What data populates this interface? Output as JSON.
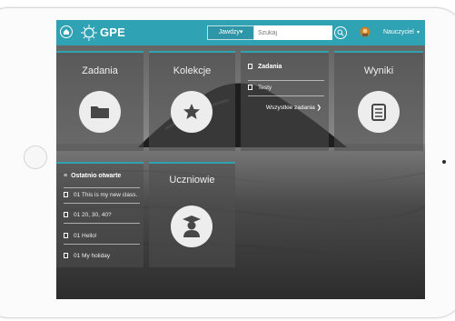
{
  "topbar": {
    "logo_text": "GPE",
    "search_scope": "Jawdzy",
    "search_placeholder": "Szukaj",
    "user_label": "Nauczyciel",
    "user_caret": "▾"
  },
  "tiles": {
    "zadania": {
      "title": "Zadania",
      "icon": "folder-icon"
    },
    "kolekcje": {
      "title": "Kolekcje",
      "icon": "star-icon"
    },
    "wyniki": {
      "title": "Wyniki",
      "icon": "document-list-icon"
    },
    "uczniowie": {
      "title": "Uczniowie",
      "icon": "student-icon"
    },
    "assignments_list": {
      "title": "Zadania",
      "items": [
        "Testy"
      ],
      "more_link": "Wszystkie zadania ❯"
    },
    "recent": {
      "title": "Ostatnio otwarte",
      "items": [
        "01 This is my new class.",
        "01 20, 30, 40?",
        "01 Hello!",
        "01 My holiday"
      ]
    }
  },
  "colors": {
    "accent": "#2fa2b3",
    "tile": "#4e4e4e"
  }
}
